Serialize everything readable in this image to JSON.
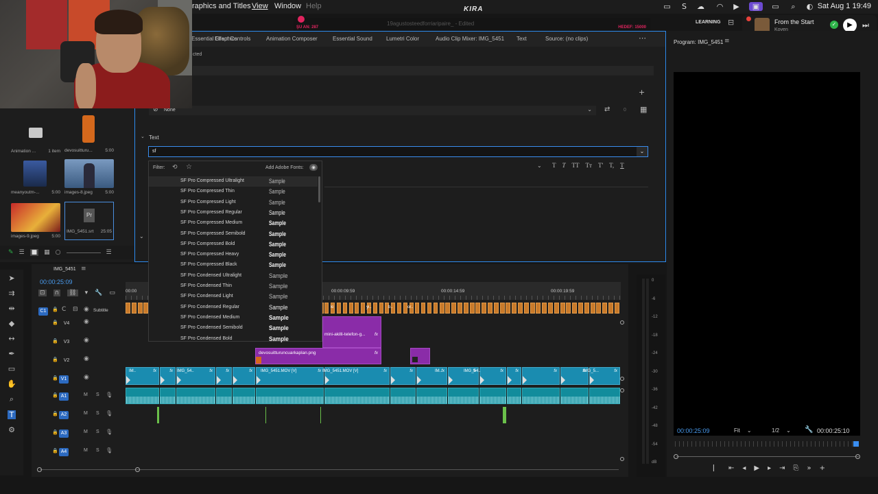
{
  "menubar": {
    "items": [
      "raphics and Titles",
      "View",
      "Window",
      "Help"
    ],
    "now_playing": {
      "title": "From the Start",
      "artist": "Koven"
    },
    "workspace": "LEARNING",
    "clock": "Sat Aug 1  19:49"
  },
  "stream_overlay": {
    "brand": "KIRA",
    "current_label": "ŞU AN:",
    "current_value": "287",
    "goal_label": "HEDEF:",
    "goal_value": "15000",
    "project_name": "19agustosteedforriaripaire_ - Edited"
  },
  "essential_graphics": {
    "tabs": [
      "Essential Graphics",
      "Effect Controls",
      "Animation Composer",
      "Essential Sound",
      "Lumetri Color",
      "Audio Clip Mixer: IMG_5451",
      "Text",
      "Source: (no clips)"
    ],
    "selection": "cted",
    "style_value": "None",
    "opacity_value": "0",
    "text_section": "Text",
    "font_search_value": "sf"
  },
  "font_dropdown": {
    "filter_label": "Filter:",
    "add_fonts_label": "Add Adobe Fonts:",
    "sample_text": "Sample",
    "fonts": [
      "SF Pro Compressed Ultralight",
      "SF Pro Compressed Thin",
      "SF Pro Compressed Light",
      "SF Pro Compressed Regular",
      "SF Pro Compressed Medium",
      "SF Pro Compressed Semibold",
      "SF Pro Compressed Bold",
      "SF Pro Compressed Heavy",
      "SF Pro Compressed Black",
      "SF Pro Condensed Ultralight",
      "SF Pro Condensed Thin",
      "SF Pro Condensed Light",
      "SF Pro Condensed Regular",
      "SF Pro Condensed Medium",
      "SF Pro Condensed Semibold",
      "SF Pro Condensed Bold"
    ],
    "weights": [
      100,
      200,
      300,
      400,
      500,
      600,
      700,
      800,
      900,
      100,
      200,
      300,
      400,
      500,
      600,
      700
    ]
  },
  "bin": {
    "items": [
      {
        "name": "Animation ...",
        "meta": "1 item"
      },
      {
        "name": "devosuitturu...",
        "meta": "5:00"
      },
      {
        "name": "meanyoutm-...",
        "meta": "5:00"
      },
      {
        "name": "images-8.jpeg",
        "meta": "5:00"
      },
      {
        "name": "images-9.jpeg",
        "meta": "5:00"
      },
      {
        "name": "IMG_5451.srt",
        "meta": "25:05"
      }
    ]
  },
  "program": {
    "title": "Program: IMG_5451",
    "timecode": "00:00:25:09",
    "fit": "Fit",
    "resolution": "1/2",
    "duration": "00:00:25:10"
  },
  "timeline": {
    "sequence": "IMG_5451",
    "timecode": "00:00:25:09",
    "ruler": [
      "00:00",
      "00:00:09:59",
      "00:00:14:59",
      "00:00:19:59"
    ],
    "tracks": {
      "caption": {
        "id": "C1",
        "name": "Subtitle"
      },
      "video": [
        "V4",
        "V3",
        "V2",
        "V1"
      ],
      "audio": [
        "A1",
        "A2",
        "A3",
        "A4"
      ]
    },
    "clips": {
      "v4_label": "mini-akilli-telefon-g...",
      "v2_label": "devosuitturuncuarkaplan.png",
      "v1_labels": [
        "IM..",
        "IMG_54..",
        "IMG_5451.MOV [V]",
        "IMG_5451.MOV [V]",
        "IM..",
        "IMG_54..",
        "IMG_5..."
      ],
      "subtitle_labels": [
        "ki",
        "b..",
        "yi..",
        "or.."
      ],
      "fx": "fx"
    },
    "meter_scale": [
      "0",
      "-6",
      "-12",
      "-18",
      "-24",
      "-30",
      "-36",
      "-42",
      "-48",
      "-54",
      "dB"
    ]
  }
}
